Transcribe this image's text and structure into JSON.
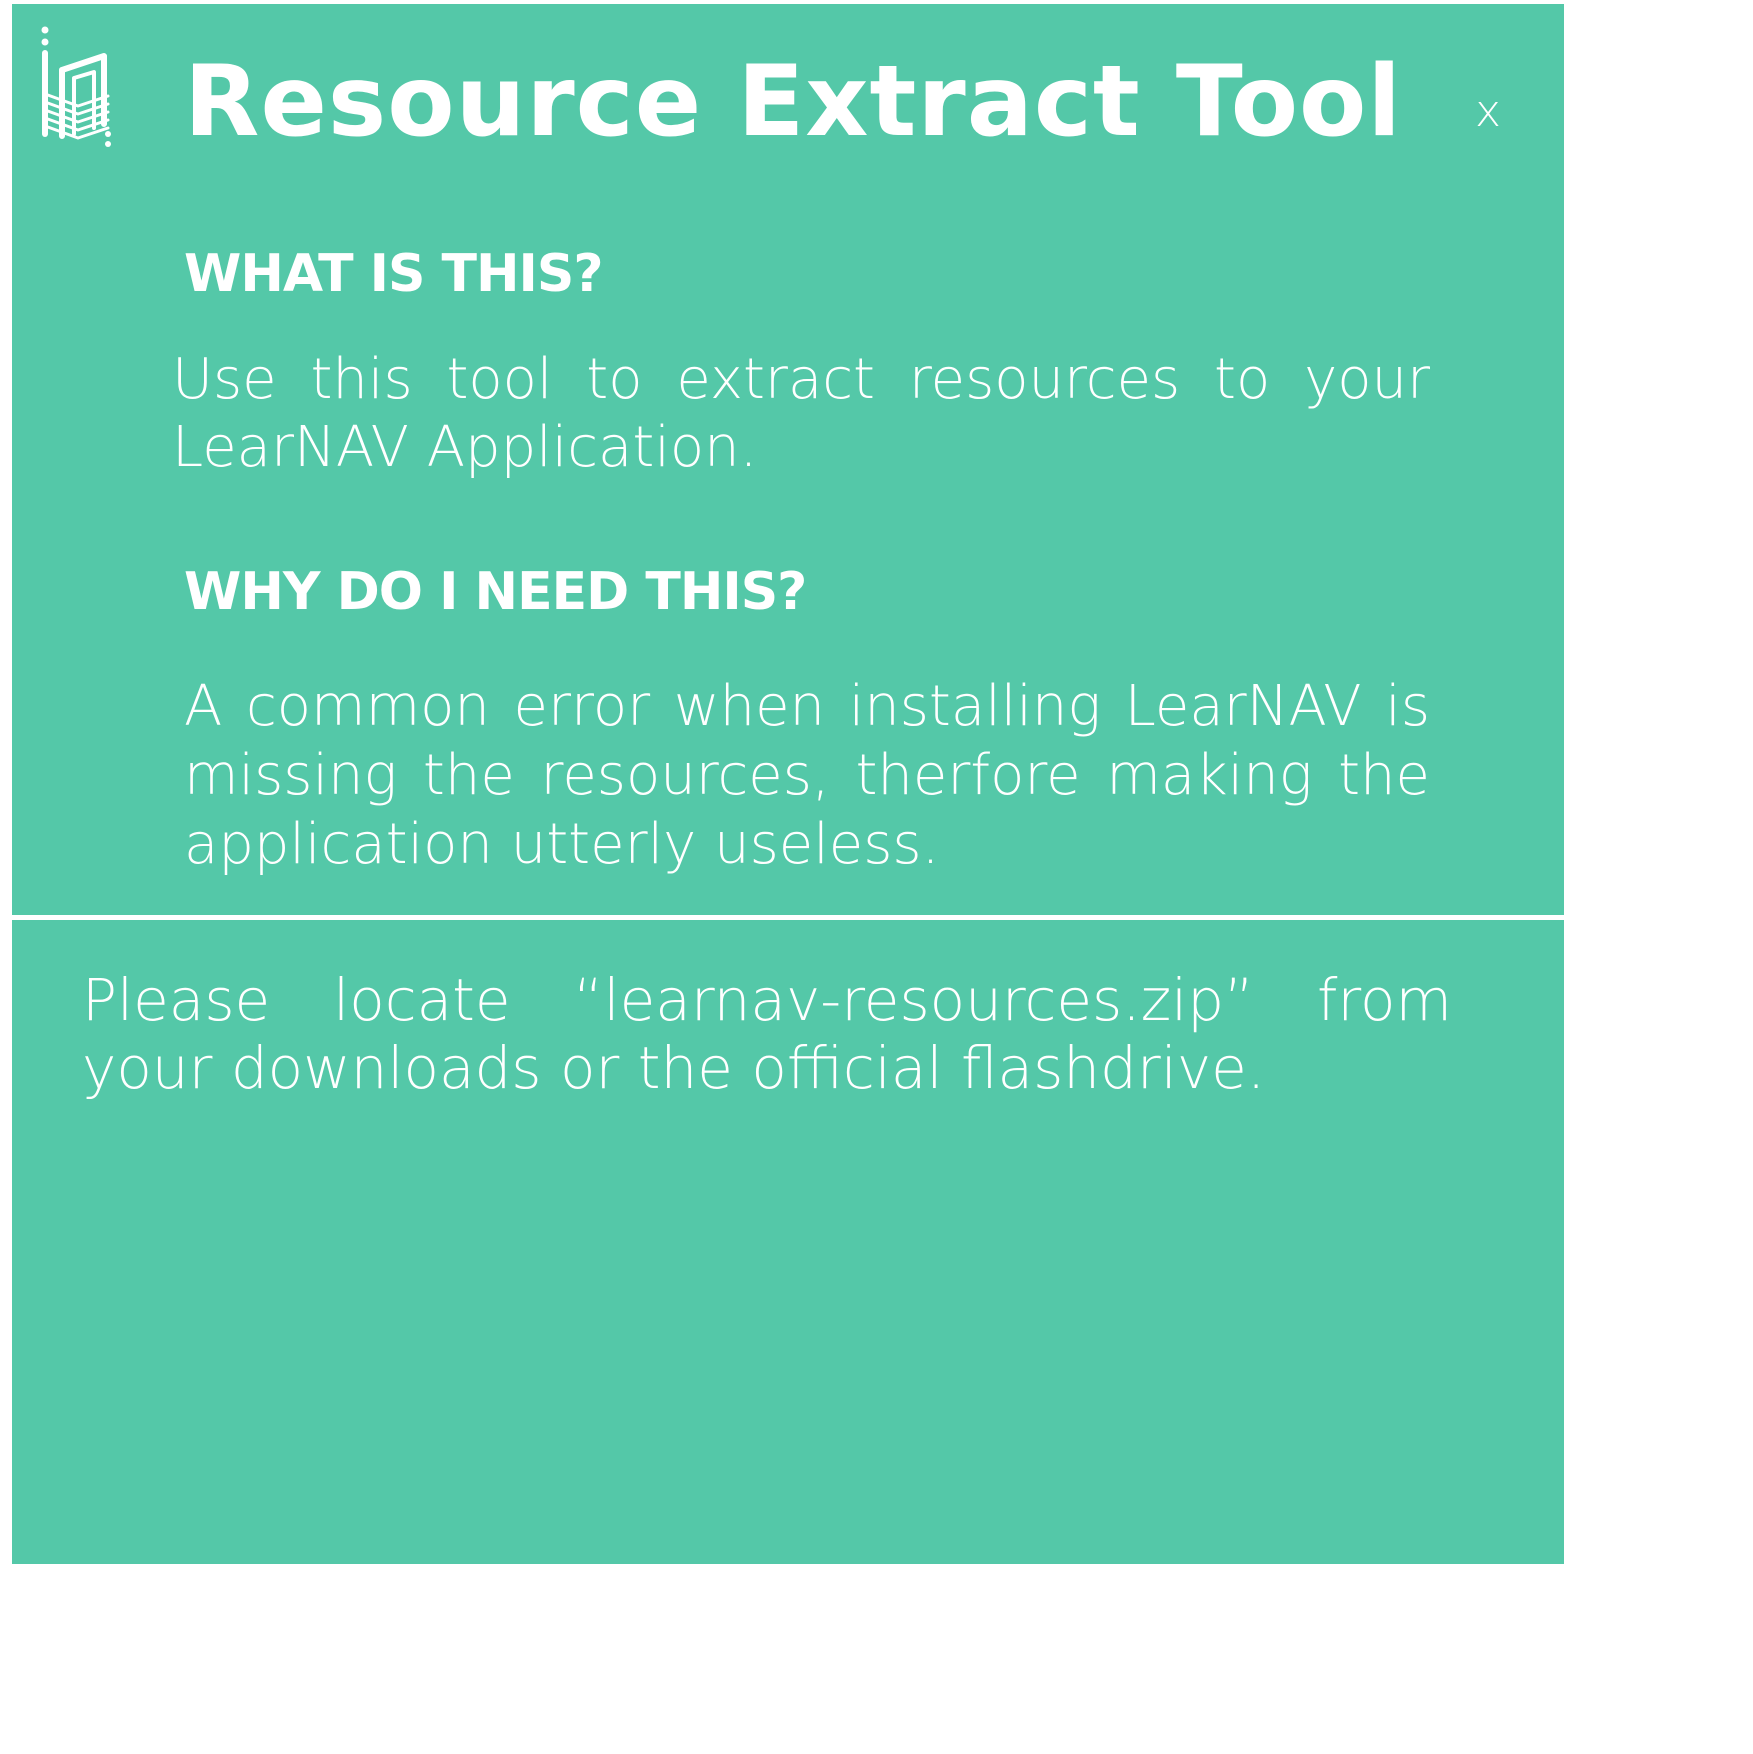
{
  "app": {
    "title": "Resource Extract Tool",
    "close_label": "x",
    "logo_icon": "learnav-logo-icon",
    "colors": {
      "background": "#54c8a8",
      "text": "#ffffff"
    }
  },
  "info": {
    "what_heading": "WHAT IS THIS?",
    "what_text": "Use this tool to extract resources to your LearNAV Application.",
    "why_heading": "WHY DO I NEED THIS?",
    "why_text": "A common error when installing LearNAV is missing the resources, therfore making the application utterly useless."
  },
  "action": {
    "instruction": "Please locate “learnav-resources.zip” from your downloads or the official flashdrive."
  }
}
